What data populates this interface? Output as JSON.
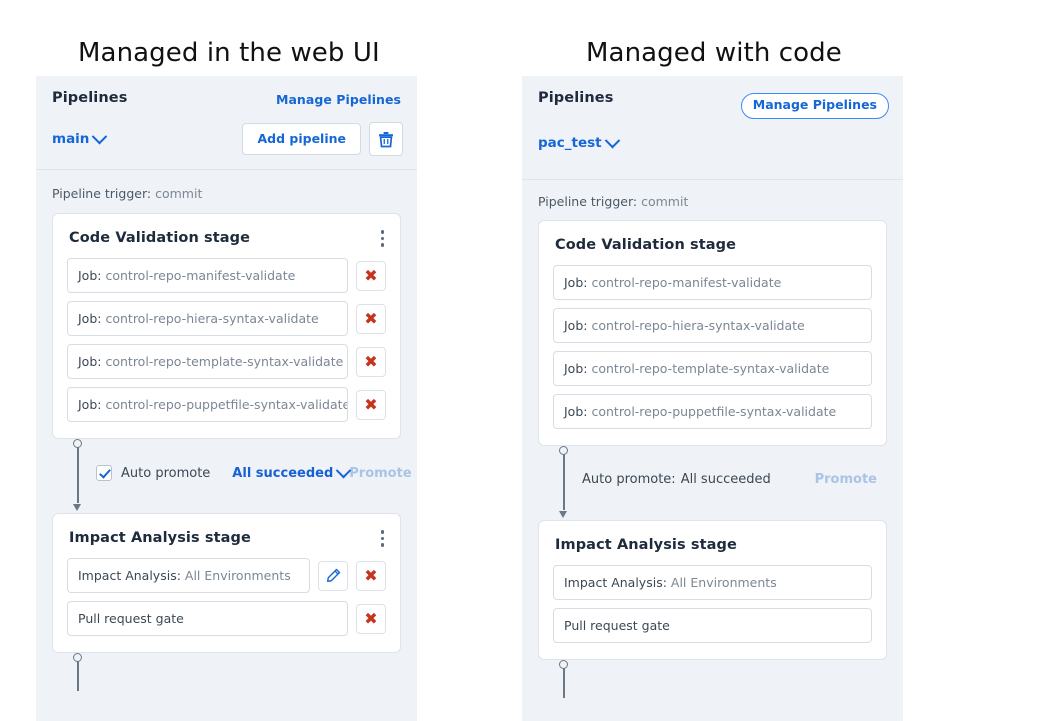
{
  "headings": {
    "left": "Managed in the web UI",
    "right": "Managed with code"
  },
  "left_panel": {
    "title": "Pipelines",
    "manage_link": "Manage Pipelines",
    "branch": "main",
    "add_pipeline_label": "Add pipeline",
    "delete_icon": "trash-icon",
    "chevron_icon": "chevron-down-icon",
    "trigger_label": "Pipeline trigger:",
    "trigger_value": "commit",
    "stages": [
      {
        "title": "Code Validation stage",
        "menu_icon": "kebab-menu-icon",
        "items": [
          {
            "label": "Job:",
            "value": "control-repo-manifest-validate",
            "delete_icon": "close-x-icon"
          },
          {
            "label": "Job:",
            "value": "control-repo-hiera-syntax-validate",
            "delete_icon": "close-x-icon"
          },
          {
            "label": "Job:",
            "value": "control-repo-template-syntax-validate",
            "delete_icon": "close-x-icon"
          },
          {
            "label": "Job:",
            "value": "control-repo-puppetfile-syntax-validate",
            "delete_icon": "close-x-icon"
          }
        ]
      },
      {
        "title": "Impact Analysis stage",
        "menu_icon": "kebab-menu-icon",
        "items": [
          {
            "label": "Impact Analysis:",
            "value": "All Environments",
            "edit_icon": "pencil-icon",
            "delete_icon": "close-x-icon"
          },
          {
            "label": "Pull request gate",
            "value": "",
            "delete_icon": "close-x-icon"
          }
        ]
      }
    ],
    "promote": {
      "auto_promote_label": "Auto promote",
      "checked": true,
      "condition": "All succeeded",
      "condition_chevron": "chevron-down-icon",
      "promote_action": "Promote"
    }
  },
  "right_panel": {
    "title": "Pipelines",
    "manage_button": "Manage Pipelines",
    "branch": "pac_test",
    "chevron_icon": "chevron-down-icon",
    "trigger_label": "Pipeline trigger:",
    "trigger_value": "commit",
    "stages": [
      {
        "title": "Code Validation stage",
        "items": [
          {
            "label": "Job:",
            "value": "control-repo-manifest-validate"
          },
          {
            "label": "Job:",
            "value": "control-repo-hiera-syntax-validate"
          },
          {
            "label": "Job:",
            "value": "control-repo-template-syntax-validate"
          },
          {
            "label": "Job:",
            "value": "control-repo-puppetfile-syntax-validate"
          }
        ]
      },
      {
        "title": "Impact Analysis stage",
        "items": [
          {
            "label": "Impact Analysis:",
            "value": "All Environments"
          },
          {
            "label": "Pull request gate",
            "value": ""
          }
        ]
      }
    ],
    "promote": {
      "auto_promote_label": "Auto promote:",
      "condition": "All succeeded",
      "promote_action": "Promote"
    }
  },
  "colors": {
    "panel_bg": "#eff2f6",
    "link_blue": "#1667d6",
    "delete_red": "#c5341c",
    "disabled_blue": "#a9c4e6",
    "connector_gray": "#6b7885"
  }
}
